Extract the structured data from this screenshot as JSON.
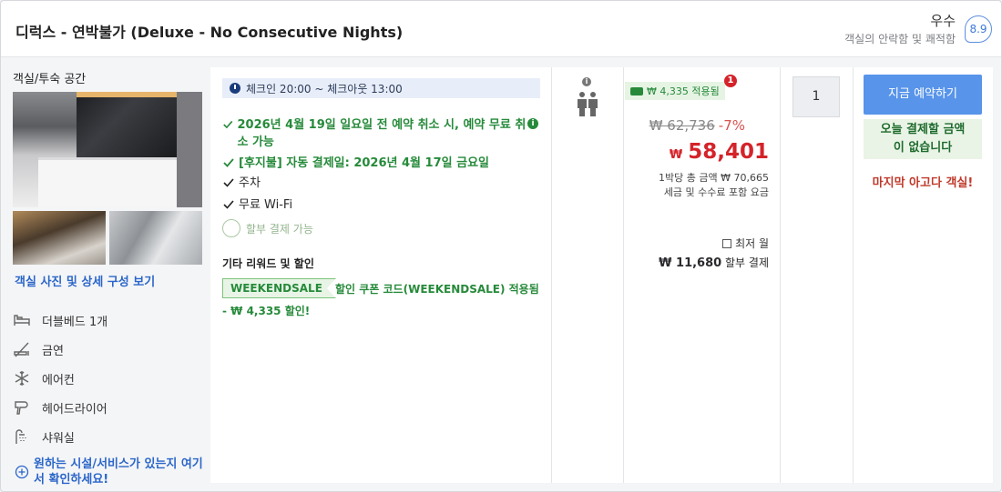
{
  "header": {
    "room_title": "디럭스 - 연박불가 (Deluxe - No Consecutive Nights)",
    "rating_label": "우수",
    "rating_sub": "객실의 안락함 및 쾌적함",
    "rating_score": "8.9"
  },
  "room": {
    "section_title": "객실/투숙 공간",
    "photo_link": "객실 사진 및 상세 구성 보기",
    "amenities": [
      {
        "label": "더블베드 1개",
        "icon": "bed-icon"
      },
      {
        "label": "금연",
        "icon": "no-smoking-icon"
      },
      {
        "label": "에어컨",
        "icon": "snowflake-icon"
      },
      {
        "label": "헤어드라이어",
        "icon": "hair-dryer-icon"
      },
      {
        "label": "샤워실",
        "icon": "shower-icon"
      }
    ],
    "more_link": "원하는 시설/서비스가 있는지 여기서 확인하세요!"
  },
  "offer": {
    "checkin": "체크인 20:00 ~ 체크아웃 13:00",
    "benefits": [
      "2026년 4월 19일 일요일 전 예약 취소 시, 예약 무료 취소 가능",
      "[후지불] 자동 결제일: 2026년 4월 17일 금요일",
      "주차",
      "무료 Wi-Fi"
    ],
    "installment": "할부 결제 가능",
    "other_label": "기타 리워드 및 할인",
    "coupon_code": "WEEKENDSALE",
    "coupon_text": "할인 쿠폰 코드(WEEKENDSALE) 적용됨",
    "coupon_discount": "- ₩ 4,335 할인!"
  },
  "price": {
    "savings_badge": "₩ 4,335 적용됨",
    "savings_count": "1",
    "original": "₩ 62,736",
    "discount_pct": "-7%",
    "currency": "₩",
    "final": "58,401",
    "total_note": "1박당 총 금액 ₩ 70,665",
    "tax_note": "세금 및 수수료 포함 요금",
    "monthly_label": "최저 월",
    "monthly_amount": "₩ 11,680",
    "monthly_suffix": "할부 결제"
  },
  "booking": {
    "quantity": "1",
    "book_button": "지금 예약하기",
    "no_pay_line1": "오늘 결제할 금액",
    "no_pay_line2": "이 없습니다",
    "last_room": "마지막 아고다 객실!"
  }
}
